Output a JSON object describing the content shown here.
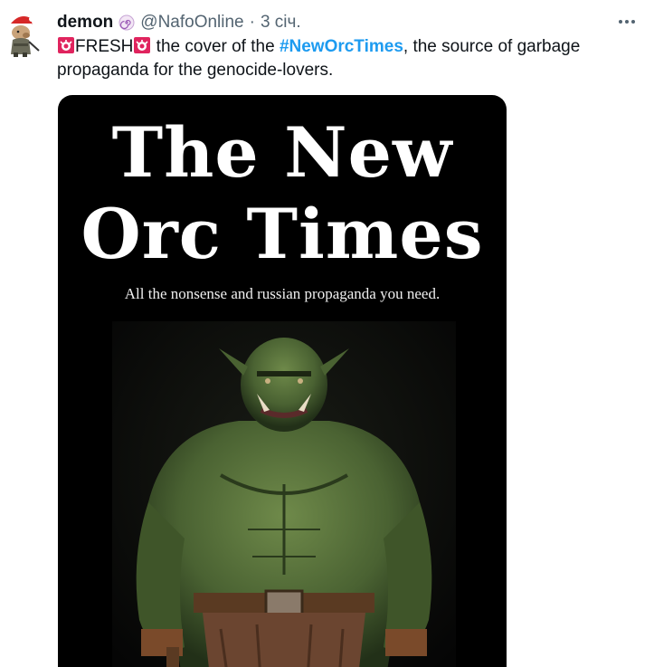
{
  "tweet": {
    "author": {
      "display_name": "demon",
      "handle": "@NafoOnline",
      "separator": "·",
      "time": "3 січ.",
      "avatar_icon": "dog-with-santa-hat-avatar",
      "badge_icon": "swirl-badge-icon"
    },
    "more_icon": "more-horizontal-icon",
    "text": {
      "siren_icon": "rotating-light-emoji",
      "word_fresh": "FRESH",
      "before_hashtag": " the cover of the ",
      "hashtag": "#NewOrcTimes",
      "after_hashtag": ", the source of garbage propaganda for the genocide-lovers."
    },
    "media": {
      "title_line_1": "The New",
      "title_line_2": "Orc Times",
      "tagline": "All the nonsense and russian propaganda you need.",
      "image_icon": "orc-illustration"
    }
  },
  "colors": {
    "text_primary": "#0f1419",
    "text_secondary": "#536471",
    "link": "#1d9bf0",
    "media_bg": "#000000"
  }
}
